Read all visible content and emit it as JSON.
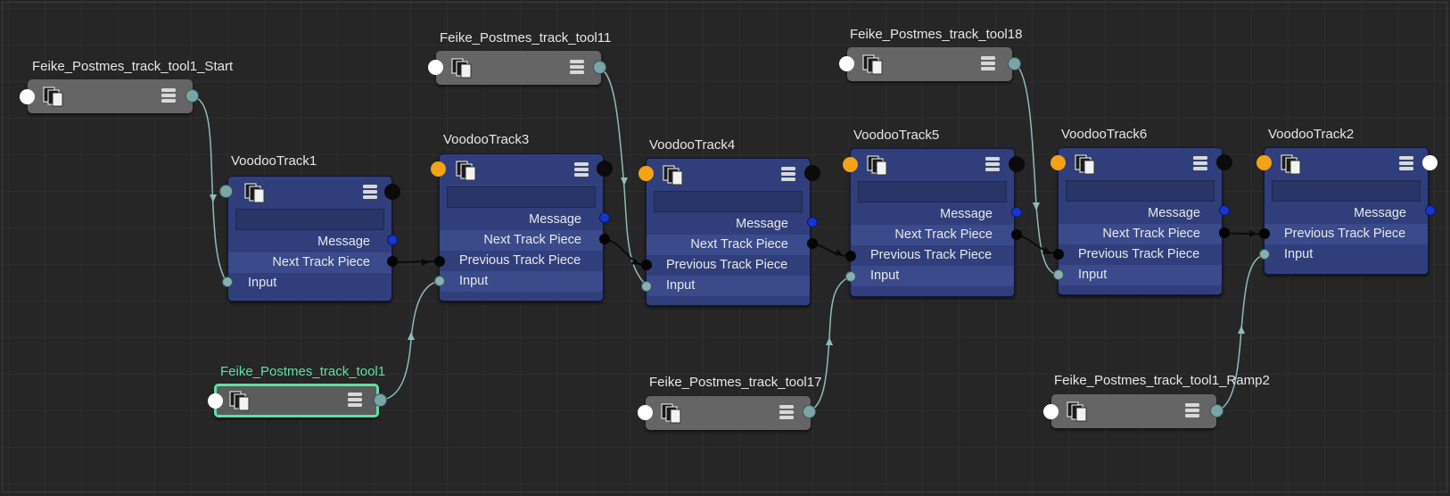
{
  "colors": {
    "wire": "#8fbcb9",
    "wire_black": "#0a0a0a",
    "selected": "#5fe0a3",
    "node_blue": "#303f7b",
    "node_grey": "#656565"
  },
  "tools": {
    "start": {
      "title": "Feike_Postmes_track_tool1_Start"
    },
    "tool11": {
      "title": "Feike_Postmes_track_tool11"
    },
    "tool18": {
      "title": "Feike_Postmes_track_tool18"
    },
    "tool1": {
      "title": "Feike_Postmes_track_tool1"
    },
    "tool17": {
      "title": "Feike_Postmes_track_tool17"
    },
    "ramp2": {
      "title": "Feike_Postmes_track_tool1_Ramp2"
    }
  },
  "tracks": {
    "t1": {
      "title": "VoodooTrack1",
      "message": "Message",
      "next": "Next Track Piece",
      "input": "Input"
    },
    "t3": {
      "title": "VoodooTrack3",
      "message": "Message",
      "next": "Next Track Piece",
      "previous": "Previous Track Piece",
      "input": "Input"
    },
    "t4": {
      "title": "VoodooTrack4",
      "message": "Message",
      "next": "Next Track Piece",
      "previous": "Previous Track Piece",
      "input": "Input"
    },
    "t5": {
      "title": "VoodooTrack5",
      "message": "Message",
      "next": "Next Track Piece",
      "previous": "Previous Track Piece",
      "input": "Input"
    },
    "t6": {
      "title": "VoodooTrack6",
      "message": "Message",
      "next": "Next Track Piece",
      "previous": "Previous Track Piece",
      "input": "Input"
    },
    "t2": {
      "title": "VoodooTrack2",
      "message": "Message",
      "previous": "Previous Track Piece",
      "input": "Input"
    }
  },
  "icons": {
    "node": "documents-icon",
    "menu": "list-icon"
  }
}
